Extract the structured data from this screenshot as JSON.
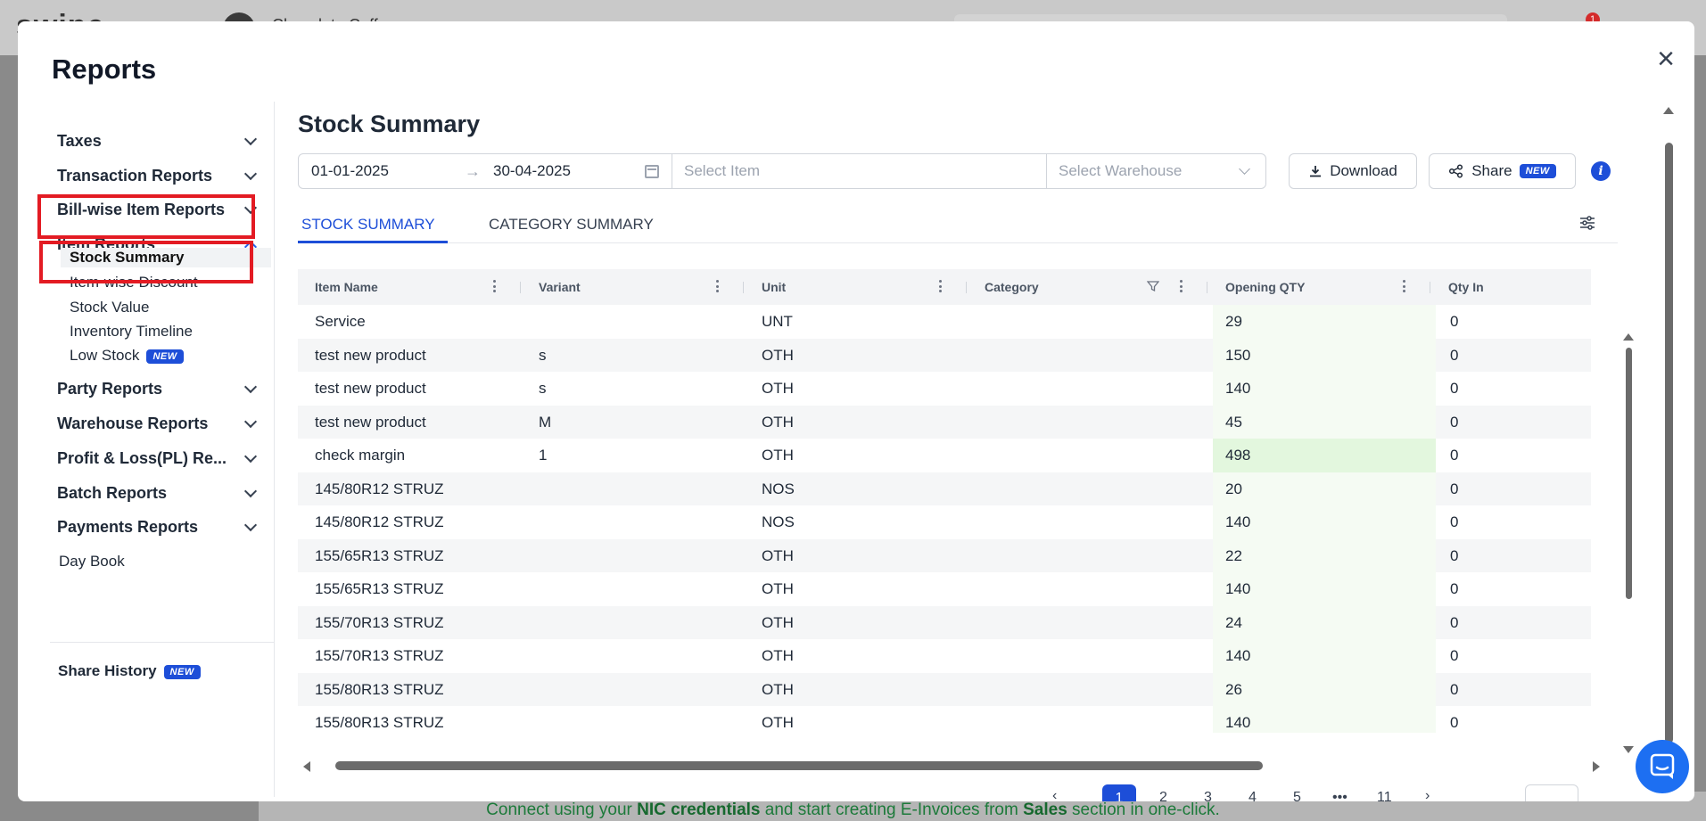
{
  "background": {
    "logo_text": "swipe",
    "company_name": "Chocolate Coffee",
    "notification_count": "1",
    "footer": {
      "prefix": "Connect using your ",
      "nic": "NIC credentials",
      "middle": " and start creating E-Invoices from ",
      "sales": "Sales",
      "suffix": " section in one-click."
    }
  },
  "modal": {
    "title": "Reports",
    "close_symbol": "×"
  },
  "sidebar": {
    "sections": [
      {
        "label": "Taxes",
        "expanded": false
      },
      {
        "label": "Transaction Reports",
        "expanded": false
      },
      {
        "label": "Bill-wise Item Reports",
        "expanded": false
      },
      {
        "label": "Item Reports",
        "expanded": true
      },
      {
        "label": "Party Reports",
        "expanded": false
      },
      {
        "label": "Warehouse Reports",
        "expanded": false
      },
      {
        "label": "Profit & Loss(PL) Re...",
        "expanded": false
      },
      {
        "label": "Batch Reports",
        "expanded": false
      },
      {
        "label": "Payments Reports",
        "expanded": false
      }
    ],
    "item_reports_children": [
      {
        "label": "Stock Summary",
        "active": true
      },
      {
        "label": "Item-wise Discount",
        "active": false
      },
      {
        "label": "Stock Value",
        "active": false
      },
      {
        "label": "Inventory Timeline",
        "active": false
      },
      {
        "label": "Low Stock",
        "active": false,
        "badge": "NEW"
      }
    ],
    "day_book": "Day Book",
    "share_history": "Share History",
    "share_history_badge": "NEW"
  },
  "main": {
    "title": "Stock Summary",
    "filters": {
      "date_from": "01-01-2025",
      "date_arrow": "→",
      "date_to": "30-04-2025",
      "item_placeholder": "Select Item",
      "warehouse_placeholder": "Select Warehouse"
    },
    "download_label": "Download",
    "share_label": "Share",
    "share_badge": "NEW",
    "info_symbol": "i",
    "tabs": [
      {
        "label": "STOCK SUMMARY",
        "active": true
      },
      {
        "label": "CATEGORY SUMMARY",
        "active": false
      }
    ]
  },
  "table": {
    "columns": [
      "Item Name",
      "Variant",
      "Unit",
      "Category",
      "Opening QTY",
      "Qty In"
    ],
    "rows": [
      {
        "item": "Service",
        "variant": "",
        "unit": "UNT",
        "category": "",
        "opening": "29",
        "qty_in": "0"
      },
      {
        "item": "test new product",
        "variant": "s",
        "unit": "OTH",
        "category": "",
        "opening": "150",
        "qty_in": "0"
      },
      {
        "item": "test new product",
        "variant": "s",
        "unit": "OTH",
        "category": "",
        "opening": "140",
        "qty_in": "0"
      },
      {
        "item": "test new product",
        "variant": "M",
        "unit": "OTH",
        "category": "",
        "opening": "45",
        "qty_in": "0"
      },
      {
        "item": "check margin",
        "variant": "1",
        "unit": "OTH",
        "category": "",
        "opening": "498",
        "qty_in": "0"
      },
      {
        "item": "145/80R12 STRUZ",
        "variant": "",
        "unit": "NOS",
        "category": "",
        "opening": "20",
        "qty_in": "0"
      },
      {
        "item": "145/80R12 STRUZ",
        "variant": "",
        "unit": "NOS",
        "category": "",
        "opening": "140",
        "qty_in": "0"
      },
      {
        "item": "155/65R13 STRUZ",
        "variant": "",
        "unit": "OTH",
        "category": "",
        "opening": "22",
        "qty_in": "0"
      },
      {
        "item": "155/65R13 STRUZ",
        "variant": "",
        "unit": "OTH",
        "category": "",
        "opening": "140",
        "qty_in": "0"
      },
      {
        "item": "155/70R13 STRUZ",
        "variant": "",
        "unit": "OTH",
        "category": "",
        "opening": "24",
        "qty_in": "0"
      },
      {
        "item": "155/70R13 STRUZ",
        "variant": "",
        "unit": "OTH",
        "category": "",
        "opening": "140",
        "qty_in": "0"
      },
      {
        "item": "155/80R13 STRUZ",
        "variant": "",
        "unit": "OTH",
        "category": "",
        "opening": "26",
        "qty_in": "0"
      },
      {
        "item": "155/80R13 STRUZ",
        "variant": "",
        "unit": "OTH",
        "category": "",
        "opening": "140",
        "qty_in": "0"
      }
    ]
  },
  "pagination": {
    "pages": [
      "1",
      "2",
      "3",
      "4",
      "5",
      "•••",
      "11"
    ],
    "active_page": "1",
    "prev_symbol": "‹",
    "next_symbol": "›"
  },
  "colors": {
    "accent": "#1d4ed8",
    "highlight_box": "#e31b23",
    "opening_heat_low": "#f5fbf3",
    "opening_heat_high": "#e3f7de"
  }
}
